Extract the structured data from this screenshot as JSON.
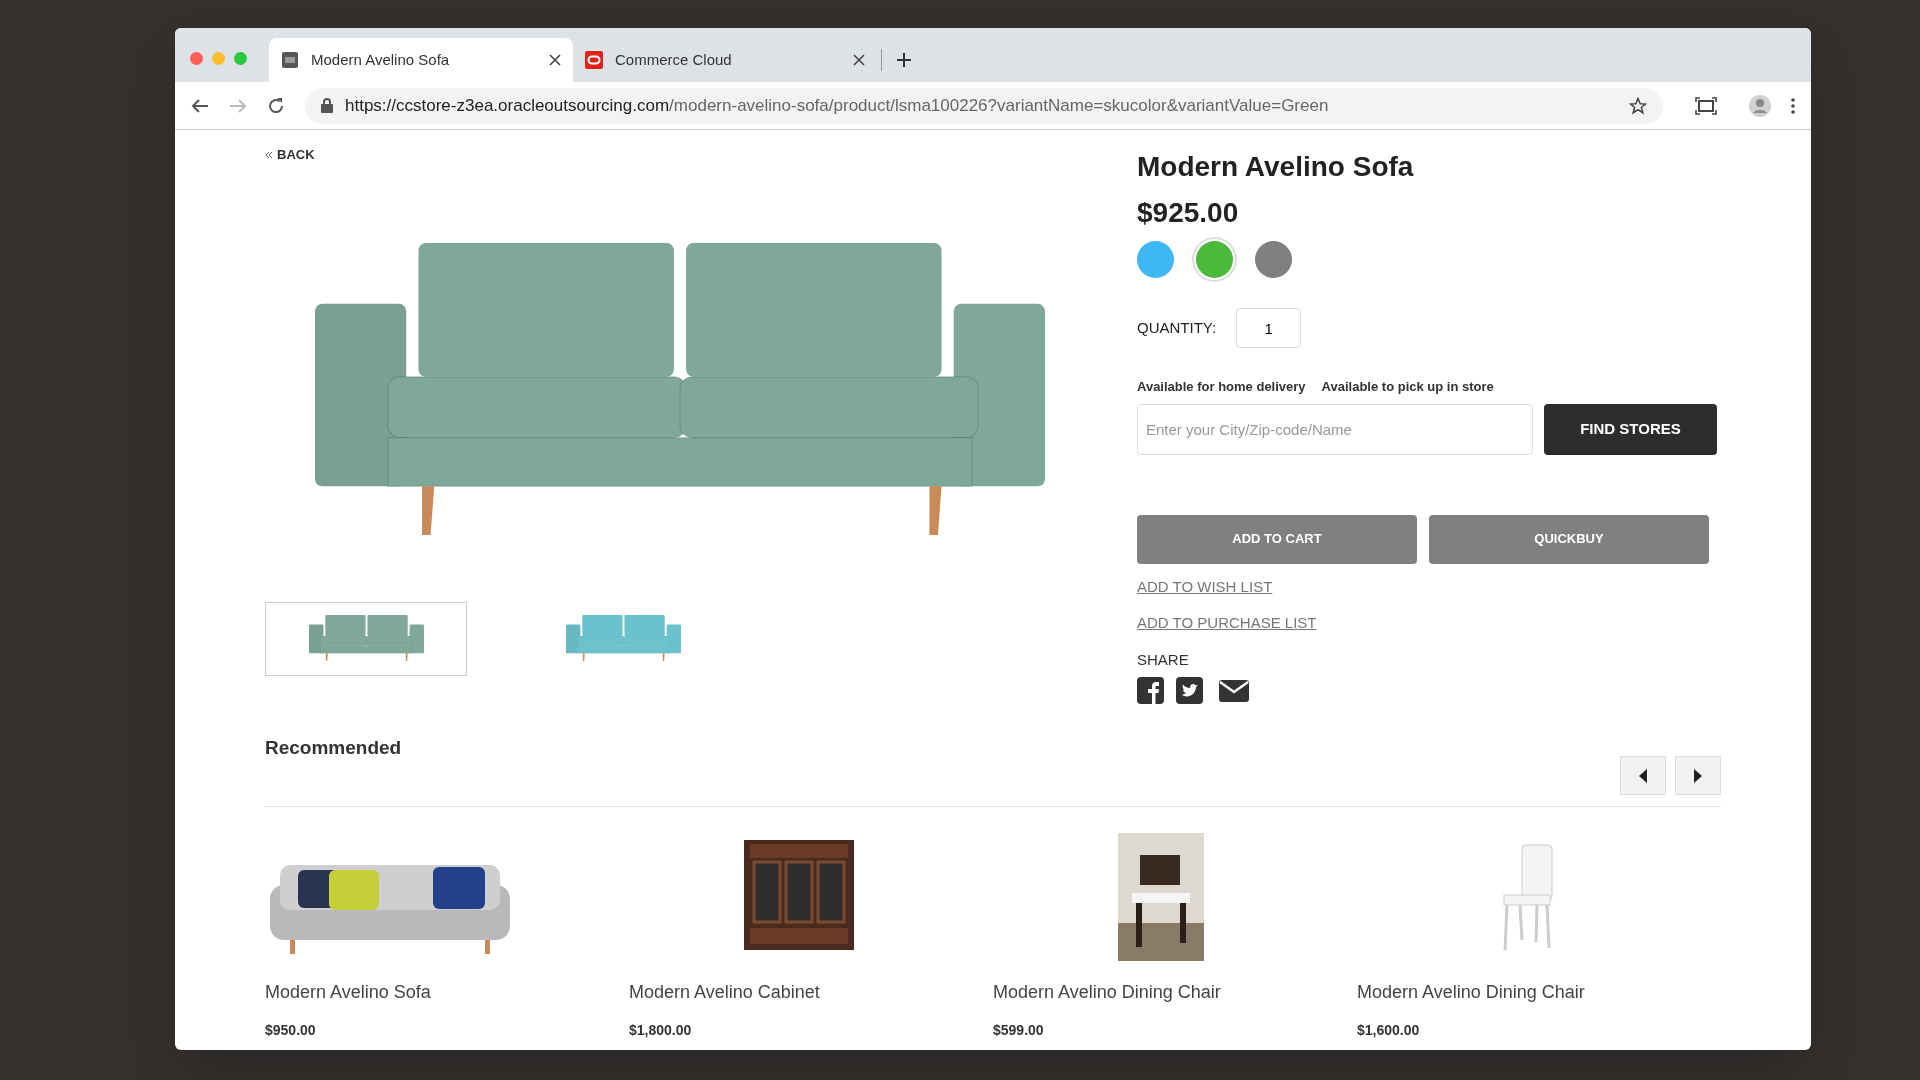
{
  "browser": {
    "tabs": [
      {
        "title": "Modern Avelino Sofa",
        "selected": true
      },
      {
        "title": "Commerce Cloud",
        "selected": false
      }
    ],
    "url": {
      "host": "https://ccstore-z3ea.oracleoutsourcing.com",
      "path": "/modern-avelino-sofa/product/lsma100226?variantName=skucolor&variantValue=Green"
    }
  },
  "page": {
    "back": "BACK",
    "thumbnails": [
      {
        "color": "#7fa898",
        "selected": true
      },
      {
        "color": "#6cc2cc",
        "selected": false
      }
    ],
    "product": {
      "title": "Modern Avelino Sofa",
      "price": "$925.00",
      "swatches": [
        {
          "color": "#3db8f5",
          "selected": false
        },
        {
          "color": "#4cb93a",
          "selected": true
        },
        {
          "color": "#808080",
          "selected": false
        }
      ],
      "quantity_label": "QUANTITY:",
      "quantity": "1",
      "availability": [
        "Available for home delivery",
        "Available to pick up in store"
      ],
      "store_search": {
        "placeholder": "Enter your City/Zip-code/Name"
      },
      "find_stores": "FIND STORES",
      "buttons": [
        "ADD TO CART",
        "QUICKBUY"
      ],
      "links": [
        "ADD TO WISH LIST",
        "ADD TO PURCHASE LIST"
      ],
      "share_label": "SHARE"
    },
    "recommended": {
      "title": "Recommended",
      "items": [
        {
          "kind": "sofa",
          "name": "Modern Avelino Sofa",
          "price": "$950.00"
        },
        {
          "kind": "cabinet",
          "name": "Modern Avelino Cabinet",
          "price": "$1,800.00"
        },
        {
          "kind": "chair_photo",
          "name": "Modern Avelino Dining Chair",
          "price": "$599.00"
        },
        {
          "kind": "chair",
          "name": "Modern Avelino Dining Chair",
          "price": "$1,600.00"
        }
      ]
    }
  }
}
